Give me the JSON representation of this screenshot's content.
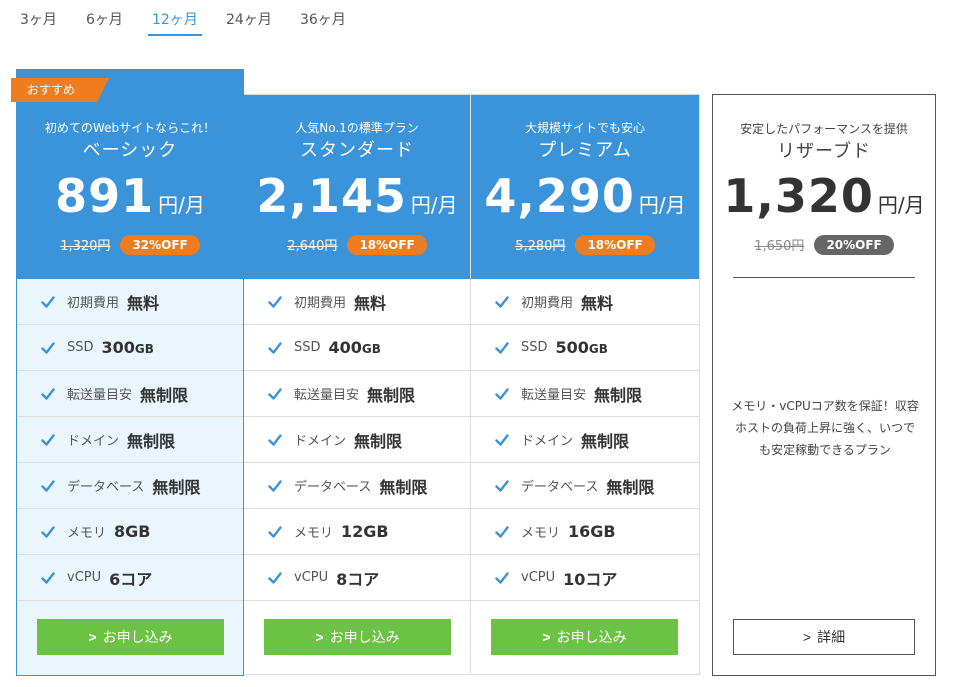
{
  "tabs": [
    {
      "label": "3ヶ月"
    },
    {
      "label": "6ヶ月"
    },
    {
      "label": "12ヶ月",
      "active": true
    },
    {
      "label": "24ヶ月"
    },
    {
      "label": "36ヶ月"
    }
  ],
  "recommend_label": "おすすめ",
  "plans": [
    {
      "tagline": "初めてのWebサイトならこれ！",
      "name": "ベーシック",
      "price": "891",
      "unit": "円/月",
      "old_price": "1,320円",
      "discount": "32%OFF",
      "features": [
        {
          "label": "初期費用",
          "value": "無料"
        },
        {
          "label": "SSD",
          "value": "300",
          "value_unit": "GB"
        },
        {
          "label": "転送量目安",
          "value": "無制限"
        },
        {
          "label": "ドメイン",
          "value": "無制限"
        },
        {
          "label": "データベース",
          "value": "無制限"
        },
        {
          "label": "メモリ",
          "value": "8GB"
        },
        {
          "label": "vCPU",
          "value": "6コア"
        }
      ],
      "button": "お申し込み"
    },
    {
      "tagline": "人気No.1の標準プラン",
      "name": "スタンダード",
      "price": "2,145",
      "unit": "円/月",
      "old_price": "2,640円",
      "discount": "18%OFF",
      "features": [
        {
          "label": "初期費用",
          "value": "無料"
        },
        {
          "label": "SSD",
          "value": "400",
          "value_unit": "GB"
        },
        {
          "label": "転送量目安",
          "value": "無制限"
        },
        {
          "label": "ドメイン",
          "value": "無制限"
        },
        {
          "label": "データベース",
          "value": "無制限"
        },
        {
          "label": "メモリ",
          "value": "12GB"
        },
        {
          "label": "vCPU",
          "value": "8コア"
        }
      ],
      "button": "お申し込み"
    },
    {
      "tagline": "大規模サイトでも安心",
      "name": "プレミアム",
      "price": "4,290",
      "unit": "円/月",
      "old_price": "5,280円",
      "discount": "18%OFF",
      "features": [
        {
          "label": "初期費用",
          "value": "無料"
        },
        {
          "label": "SSD",
          "value": "500",
          "value_unit": "GB"
        },
        {
          "label": "転送量目安",
          "value": "無制限"
        },
        {
          "label": "ドメイン",
          "value": "無制限"
        },
        {
          "label": "データベース",
          "value": "無制限"
        },
        {
          "label": "メモリ",
          "value": "16GB"
        },
        {
          "label": "vCPU",
          "value": "10コア"
        }
      ],
      "button": "お申し込み"
    }
  ],
  "reserved": {
    "tagline": "安定したパフォーマンスを提供",
    "name": "リザーブド",
    "price": "1,320",
    "unit": "円/月",
    "old_price": "1,650円",
    "discount": "20%OFF",
    "description": "メモリ・vCPUコア数を保証！収容ホストの負荷上昇に強く、いつでも安定稼動できるプラン",
    "button": "詳細"
  },
  "colors": {
    "primary": "#3b93d9",
    "accent": "#ef7d20",
    "button_green": "#6cc244",
    "featured_bg": "#eaf5fd"
  }
}
